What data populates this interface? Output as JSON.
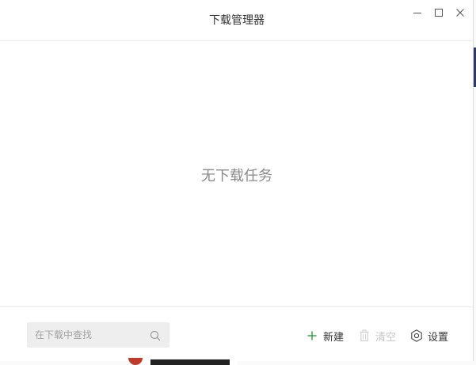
{
  "window": {
    "title": "下载管理器",
    "controls": {
      "minimize_icon": "minimize-icon",
      "maximize_icon": "maximize-icon",
      "close_icon": "close-icon"
    }
  },
  "main": {
    "empty_message": "无下载任务"
  },
  "footer": {
    "search": {
      "value": "",
      "placeholder": "在下载中查找",
      "icon": "search-icon"
    },
    "actions": {
      "new_label": "新建",
      "new_icon": "plus-icon",
      "clear_label": "清空",
      "clear_icon": "trash-icon",
      "clear_enabled": false,
      "settings_label": "设置",
      "settings_icon": "gear-icon"
    }
  },
  "colors": {
    "accent_green": "#2e9e3e",
    "text_primary": "#333333",
    "text_muted": "#8a8a8a",
    "text_disabled": "#c4c4c4",
    "search_bg": "#eeeeee"
  }
}
